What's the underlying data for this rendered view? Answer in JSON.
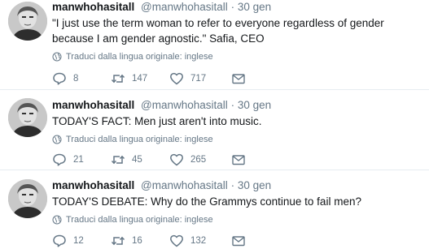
{
  "tweets": [
    {
      "name": "manwhohasitall",
      "handle": "@manwhohasitall",
      "separator": "·",
      "time": "30 gen",
      "text": "\"I just use the term woman to refer to everyone regardless of gender because I am gender agnostic.\" Safia, CEO",
      "translate": "Traduci dalla lingua originale: inglese",
      "replies": "8",
      "retweets": "147",
      "likes": "717"
    },
    {
      "name": "manwhohasitall",
      "handle": "@manwhohasitall",
      "separator": "·",
      "time": "30 gen",
      "text": "TODAY'S FACT: Men just aren't into music.",
      "translate": "Traduci dalla lingua originale: inglese",
      "replies": "21",
      "retweets": "45",
      "likes": "265"
    },
    {
      "name": "manwhohasitall",
      "handle": "@manwhohasitall",
      "separator": "·",
      "time": "30 gen",
      "text": "TODAY'S DEBATE: Why do the Grammys continue to fail men?",
      "translate": "Traduci dalla lingua originale: inglese",
      "replies": "12",
      "retweets": "16",
      "likes": "132"
    }
  ],
  "icons": {
    "avatar": "man-portrait",
    "reply": "reply-icon",
    "retweet": "retweet-icon",
    "like": "heart-icon",
    "dm": "envelope-icon",
    "translate": "globe-icon"
  },
  "colors": {
    "text": "#14171a",
    "muted": "#657786",
    "divider": "#e6ecf0"
  }
}
